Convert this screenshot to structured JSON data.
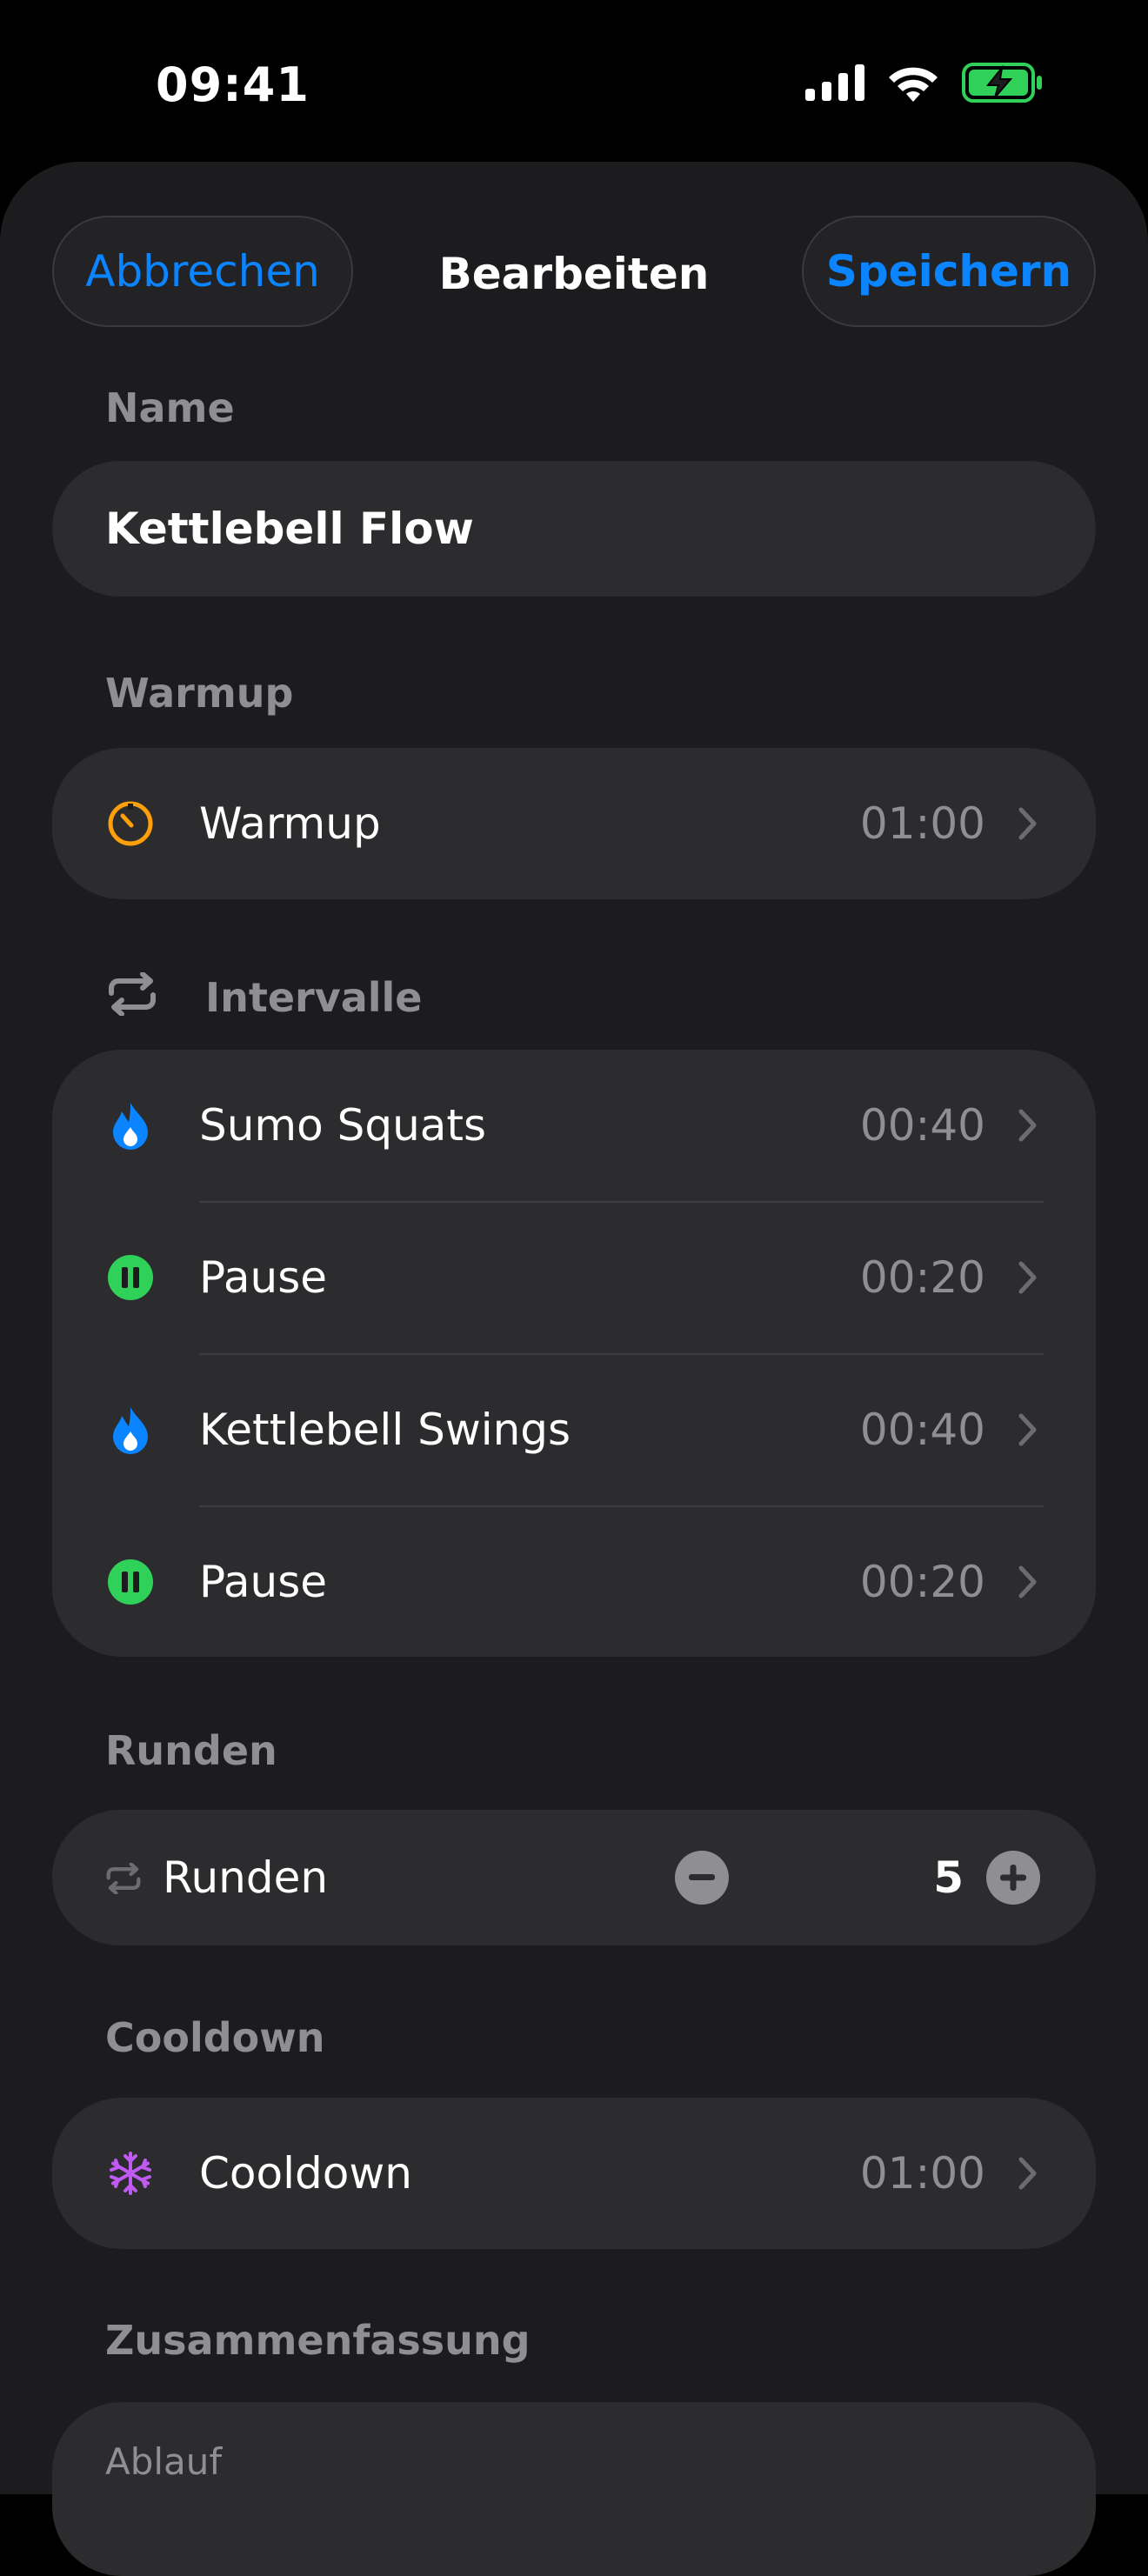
{
  "status_bar": {
    "time": "09:41",
    "icons": [
      "cellular-signal-icon",
      "wifi-icon",
      "battery-charging-icon"
    ],
    "battery_color": "#30d158"
  },
  "nav": {
    "cancel_label": "Abbrechen",
    "title": "Bearbeiten",
    "save_label": "Speichern",
    "accent": "#0a84ff"
  },
  "name_section": {
    "label": "Name",
    "value": "Kettlebell Flow"
  },
  "warmup_section": {
    "label": "Warmup",
    "row": {
      "icon": "timer-icon",
      "label": "Warmup",
      "value": "01:00",
      "icon_color": "#ff9f0a"
    }
  },
  "intervals_section": {
    "label": "Intervalle",
    "icon": "repeat-icon",
    "items": [
      {
        "icon": "flame-icon",
        "label": "Sumo Squats",
        "value": "00:40"
      },
      {
        "icon": "pause-icon",
        "label": "Pause",
        "value": "00:20"
      },
      {
        "icon": "flame-icon",
        "label": "Kettlebell Swings",
        "value": "00:40"
      },
      {
        "icon": "pause-icon",
        "label": "Pause",
        "value": "00:20"
      }
    ],
    "flame_color": "#0a84ff",
    "pause_color": "#30d158"
  },
  "rounds_section": {
    "label": "Runden",
    "row_label": "Runden",
    "value": "5",
    "icon": "repeat-icon"
  },
  "cooldown_section": {
    "label": "Cooldown",
    "row": {
      "icon": "snowflake-icon",
      "label": "Cooldown",
      "value": "01:00",
      "icon_color": "#bf5af2"
    }
  },
  "summary_section": {
    "label": "Zusammenfassung",
    "sub_label": "Ablauf"
  }
}
